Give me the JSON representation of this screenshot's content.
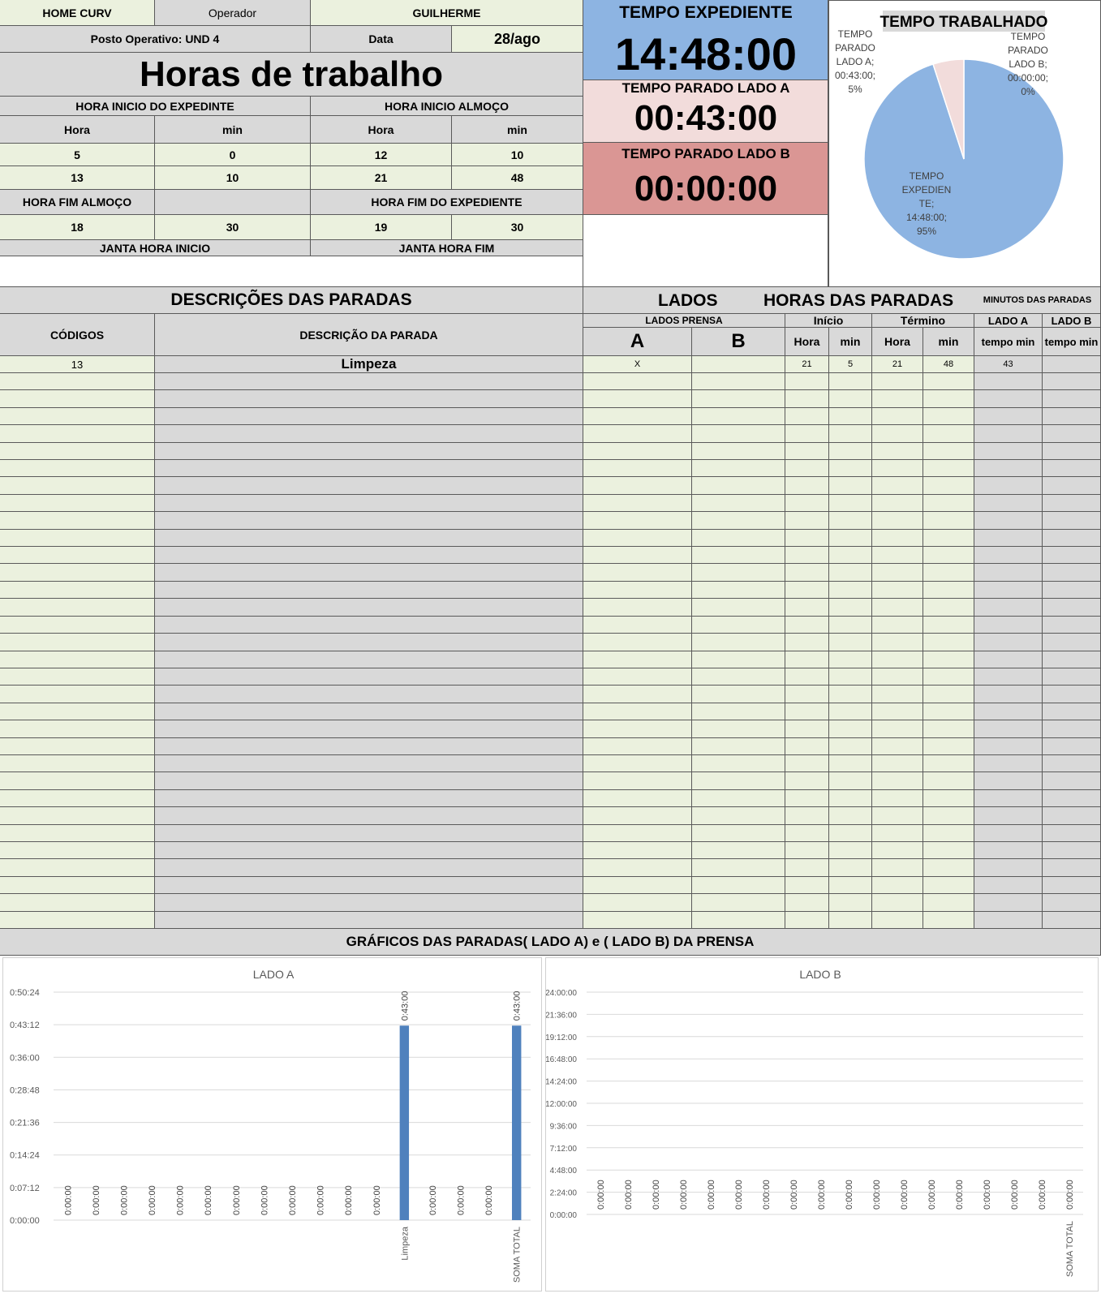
{
  "header": {
    "company": "HOME CURV",
    "operator_label": "Operador",
    "operator_name": "GUILHERME",
    "station": "Posto Operativo: UND 4",
    "date_label": "Data",
    "date_value": "28/ago",
    "title": "Horas de trabalho"
  },
  "times": {
    "start_shift_label": "HORA INICIO DO EXPEDINTE",
    "start_lunch_label": "HORA INICIO ALMOÇO",
    "hour_label": "Hora",
    "min_label": "min",
    "row1": [
      "5",
      "0",
      "12",
      "10"
    ],
    "row2": [
      "13",
      "10",
      "21",
      "48"
    ],
    "end_lunch_label": "HORA FIM ALMOÇO",
    "end_shift_label": "HORA FIM DO EXPEDIENTE",
    "row3": [
      "18",
      "30",
      "19",
      "30"
    ],
    "dinner_start_label": "JANTA HORA INICIO",
    "dinner_end_label": "JANTA HORA FIM"
  },
  "summary": {
    "shift_label": "TEMPO EXPEDIENTE",
    "shift_value": "14:48:00",
    "stopped_a_label": "TEMPO PARADO LADO A",
    "stopped_a_value": "00:43:00",
    "stopped_b_label": "TEMPO PARADO LADO B",
    "stopped_b_value": "00:00:00",
    "colors": {
      "shift": "#8db4e2",
      "stopped_a": "#f2dcdb",
      "stopped_b": "#da9694"
    }
  },
  "pie": {
    "title": "TEMPO TRABALHADO",
    "slices": [
      {
        "label_lines": [
          "TEMPO",
          "EXPEDIEN",
          "TE;",
          "14:48:00;",
          "95%"
        ],
        "value": 95,
        "color": "#8db4e2"
      },
      {
        "label_lines": [
          "TEMPO",
          "PARADO",
          "LADO A;",
          "00:43:00;",
          "5%"
        ],
        "value": 5,
        "color": "#f2dcdb"
      },
      {
        "label_lines": [
          "TEMPO",
          "PARADO",
          "LADO B;",
          "00:00:00;",
          "0%"
        ],
        "value": 0,
        "color": "#da9694"
      }
    ]
  },
  "stops": {
    "section_title": "DESCRIÇÕES DAS PARADAS",
    "lados_title": "LADOS",
    "hours_title": "HORAS DAS PARADAS",
    "minutes_title": "MINUTOS DAS PARADAS",
    "codes_header": "CÓDIGOS",
    "desc_header": "DESCRIÇÃO DA PARADA",
    "press_sides_header": "LADOS PRENSA",
    "side_a": "A",
    "side_b": "B",
    "start_header": "Início",
    "end_header": "Término",
    "lado_a_header": "LADO A",
    "lado_b_header": "LADO B",
    "hour": "Hora",
    "min": "min",
    "tempo_min": "tempo min",
    "rows": [
      {
        "code": "13",
        "desc": "Limpeza",
        "a": "X",
        "b": "",
        "start_h": "21",
        "start_m": "5",
        "end_h": "21",
        "end_m": "48",
        "min_a": "43",
        "min_b": ""
      }
    ]
  },
  "charts_title": "GRÁFICOS DAS PARADAS( LADO A) e ( LADO B) DA PRENSA",
  "chart_data": [
    {
      "type": "bar",
      "title": "LADO A",
      "ylim_seconds": [
        0,
        3024
      ],
      "y_ticks": [
        "0:00:00",
        "0:07:12",
        "0:14:24",
        "0:21:36",
        "0:28:48",
        "0:36:00",
        "0:43:12",
        "0:50:24"
      ],
      "categories": [
        "",
        "",
        "",
        "",
        "",
        "",
        "",
        "",
        "",
        "",
        "",
        "",
        "Limpeza",
        "",
        "",
        "",
        "SOMA TOTAL"
      ],
      "values_seconds": [
        0,
        0,
        0,
        0,
        0,
        0,
        0,
        0,
        0,
        0,
        0,
        0,
        2580,
        0,
        0,
        0,
        2580
      ],
      "data_labels": [
        "0:00:00",
        "0:00:00",
        "0:00:00",
        "0:00:00",
        "0:00:00",
        "0:00:00",
        "0:00:00",
        "0:00:00",
        "0:00:00",
        "0:00:00",
        "0:00:00",
        "0:00:00",
        "0:43:00",
        "0:00:00",
        "0:00:00",
        "0:00:00",
        "0:43:00"
      ],
      "color": "#4f81bd",
      "grid": true
    },
    {
      "type": "bar",
      "title": "LADO B",
      "ylim_seconds": [
        0,
        86400
      ],
      "y_ticks": [
        "0:00:00",
        "2:24:00",
        "4:48:00",
        "7:12:00",
        "9:36:00",
        "12:00:00",
        "14:24:00",
        "16:48:00",
        "19:12:00",
        "21:36:00",
        "24:00:00"
      ],
      "categories": [
        "",
        "",
        "",
        "",
        "",
        "",
        "",
        "",
        "",
        "",
        "",
        "",
        "",
        "",
        "",
        "",
        "",
        "SOMA TOTAL"
      ],
      "values_seconds": [
        0,
        0,
        0,
        0,
        0,
        0,
        0,
        0,
        0,
        0,
        0,
        0,
        0,
        0,
        0,
        0,
        0,
        0
      ],
      "data_labels": [
        "0:00:00",
        "0:00:00",
        "0:00:00",
        "0:00:00",
        "0:00:00",
        "0:00:00",
        "0:00:00",
        "0:00:00",
        "0:00:00",
        "0:00:00",
        "0:00:00",
        "0:00:00",
        "0:00:00",
        "0:00:00",
        "0:00:00",
        "0:00:00",
        "0:00:00",
        "0:00:00"
      ],
      "color": "#4f81bd",
      "grid": true
    }
  ]
}
